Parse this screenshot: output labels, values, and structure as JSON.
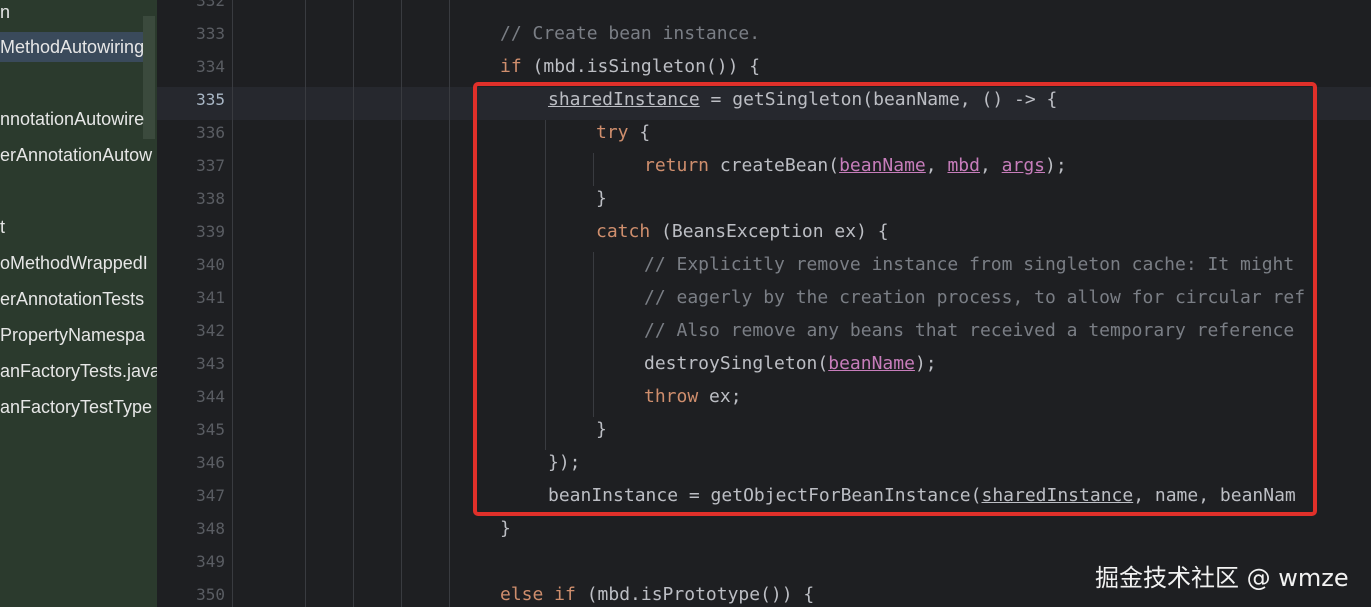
{
  "sidebar": {
    "items": [
      {
        "label": "n",
        "selected": false
      },
      {
        "label": "MethodAutowiring",
        "selected": true
      },
      {
        "label": "nnotationAutowire",
        "selected": false
      },
      {
        "label": "erAnnotationAutow",
        "selected": false
      },
      {
        "label": "t",
        "selected": false
      },
      {
        "label": "oMethodWrappedI",
        "selected": false
      },
      {
        "label": "erAnnotationTests",
        "selected": false
      },
      {
        "label": "PropertyNamespa",
        "selected": false
      },
      {
        "label": "anFactoryTests.java",
        "selected": false
      },
      {
        "label": "anFactoryTestType",
        "selected": false
      }
    ]
  },
  "editor": {
    "current_line": "335",
    "lines": [
      {
        "num": "332",
        "text": ""
      },
      {
        "num": "333",
        "text": "// Create bean instance."
      },
      {
        "num": "334",
        "text": "if (mbd.isSingleton()) {"
      },
      {
        "num": "335",
        "text": "sharedInstance = getSingleton(beanName, () -> {"
      },
      {
        "num": "336",
        "text": "try {"
      },
      {
        "num": "337",
        "text": "return createBean(beanName, mbd, args);"
      },
      {
        "num": "338",
        "text": "}"
      },
      {
        "num": "339",
        "text": "catch (BeansException ex) {"
      },
      {
        "num": "340",
        "text": "// Explicitly remove instance from singleton cache: It might"
      },
      {
        "num": "341",
        "text": "// eagerly by the creation process, to allow for circular ref"
      },
      {
        "num": "342",
        "text": "// Also remove any beans that received a temporary reference"
      },
      {
        "num": "343",
        "text": "destroySingleton(beanName);"
      },
      {
        "num": "344",
        "text": "throw ex;"
      },
      {
        "num": "345",
        "text": "}"
      },
      {
        "num": "346",
        "text": "});"
      },
      {
        "num": "347",
        "text": "beanInstance = getObjectForBeanInstance(sharedInstance, name, beanNam"
      },
      {
        "num": "348",
        "text": "}"
      },
      {
        "num": "349",
        "text": ""
      },
      {
        "num": "350",
        "text": "else if (mbd.isPrototype()) {"
      }
    ]
  },
  "watermark": "掘金技术社区 @ wmze",
  "colors": {
    "keyword": "#cf8e6d",
    "comment": "#7a7e85",
    "parameter": "#c77dbb",
    "highlight_box": "#e0302a"
  }
}
